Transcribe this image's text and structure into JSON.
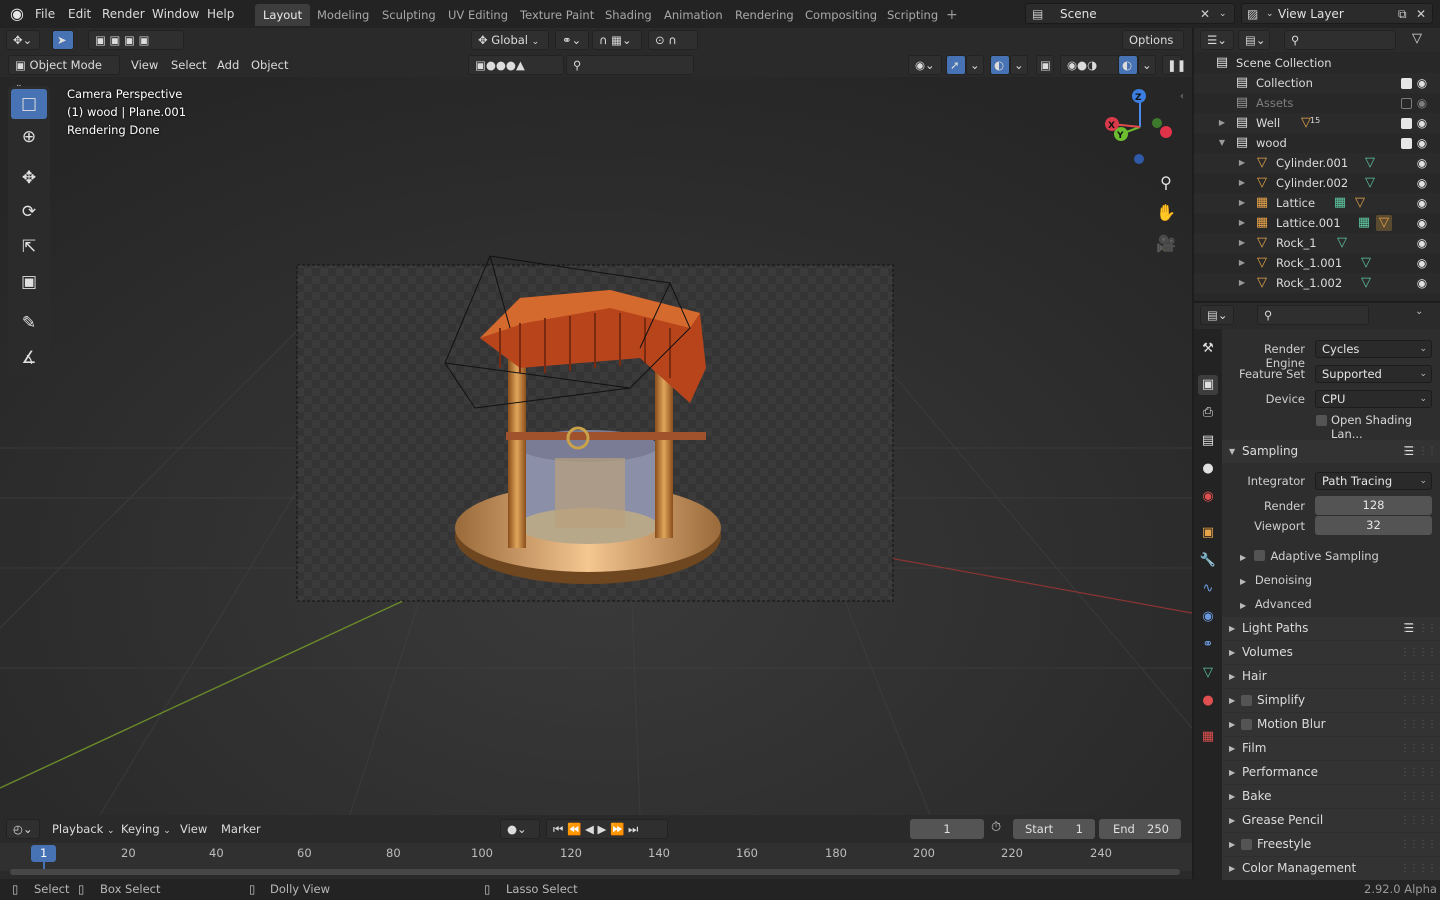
{
  "topbar": {
    "menus": [
      "File",
      "Edit",
      "Render",
      "Window",
      "Help"
    ],
    "workspaces": [
      "Layout",
      "Modeling",
      "Sculpting",
      "UV Editing",
      "Texture Paint",
      "Shading",
      "Animation",
      "Rendering",
      "Compositing",
      "Scripting"
    ],
    "active_workspace": "Layout",
    "add_tab": "+",
    "scene": "Scene",
    "view_layer": "View Layer"
  },
  "viewport": {
    "transform_orientation": "Global",
    "options_label": "Options",
    "mode": "Object Mode",
    "menus": [
      "View",
      "Select",
      "Add",
      "Object"
    ],
    "overlay_lines": [
      "Camera Perspective",
      "(1) wood | Plane.001",
      "Rendering Done"
    ],
    "gizmo_axes": {
      "x": "X",
      "y": "Y",
      "z": "Z"
    }
  },
  "timeline": {
    "menus": [
      "Playback",
      "Keying",
      "View",
      "Marker"
    ],
    "current_frame": "1",
    "start_label": "Start",
    "start": "1",
    "end_label": "End",
    "end": "250",
    "ruler": [
      "1",
      "20",
      "40",
      "60",
      "80",
      "100",
      "120",
      "140",
      "160",
      "180",
      "200",
      "220",
      "240"
    ]
  },
  "statusbar": {
    "items": [
      "Select",
      "Box Select",
      "Dolly View",
      "Lasso Select"
    ],
    "version": "2.92.0 Alpha"
  },
  "outliner": {
    "root": "Scene Collection",
    "rows": [
      {
        "label": "Collection",
        "type": "collection",
        "checked": true
      },
      {
        "label": "Assets",
        "type": "collection",
        "checked": false
      },
      {
        "label": "Well",
        "type": "collection",
        "checked": true,
        "badge": "15"
      },
      {
        "label": "wood",
        "type": "collection",
        "checked": true
      },
      {
        "label": "Cylinder.001",
        "type": "mesh"
      },
      {
        "label": "Cylinder.002",
        "type": "mesh"
      },
      {
        "label": "Lattice",
        "type": "lattice"
      },
      {
        "label": "Lattice.001",
        "type": "lattice"
      },
      {
        "label": "Rock_1",
        "type": "mesh"
      },
      {
        "label": "Rock_1.001",
        "type": "mesh"
      },
      {
        "label": "Rock_1.002",
        "type": "mesh"
      }
    ]
  },
  "properties": {
    "render_engine_label": "Render Engine",
    "render_engine": "Cycles",
    "feature_set_label": "Feature Set",
    "feature_set": "Supported",
    "device_label": "Device",
    "device": "CPU",
    "osl_label": "Open Shading Lan...",
    "sampling": {
      "title": "Sampling",
      "integrator_label": "Integrator",
      "integrator": "Path Tracing",
      "render_label": "Render",
      "render": "128",
      "viewport_label": "Viewport",
      "viewport": "32",
      "subpanels": [
        "Adaptive Sampling",
        "Denoising",
        "Advanced"
      ]
    },
    "panels": [
      "Light Paths",
      "Volumes",
      "Hair",
      "Simplify",
      "Motion Blur",
      "Film",
      "Performance",
      "Bake",
      "Grease Pencil",
      "Freestyle",
      "Color Management"
    ]
  }
}
